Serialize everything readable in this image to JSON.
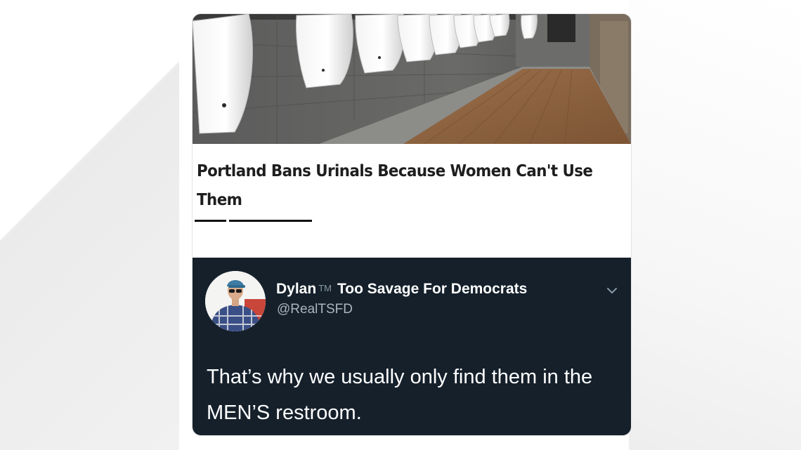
{
  "article": {
    "photo_icon": "restroom-urinals-photo",
    "headline": "Portland Bans Urinals Because Women Can't Use Them"
  },
  "tweet": {
    "avatar_icon": "profile-photo-avatar",
    "author": {
      "name": "Dylan",
      "tm": "TM",
      "name_suffix": "Too Savage For Democrats"
    },
    "handle": "@RealTSFD",
    "menu_icon": "chevron-down-icon",
    "text": "That’s why we usually only find them in the MEN’S restroom."
  },
  "colors": {
    "tweet_background": "#15202b",
    "tweet_text": "#ffffff",
    "handle": "#a9b4be",
    "headline": "#1e1e1e"
  }
}
